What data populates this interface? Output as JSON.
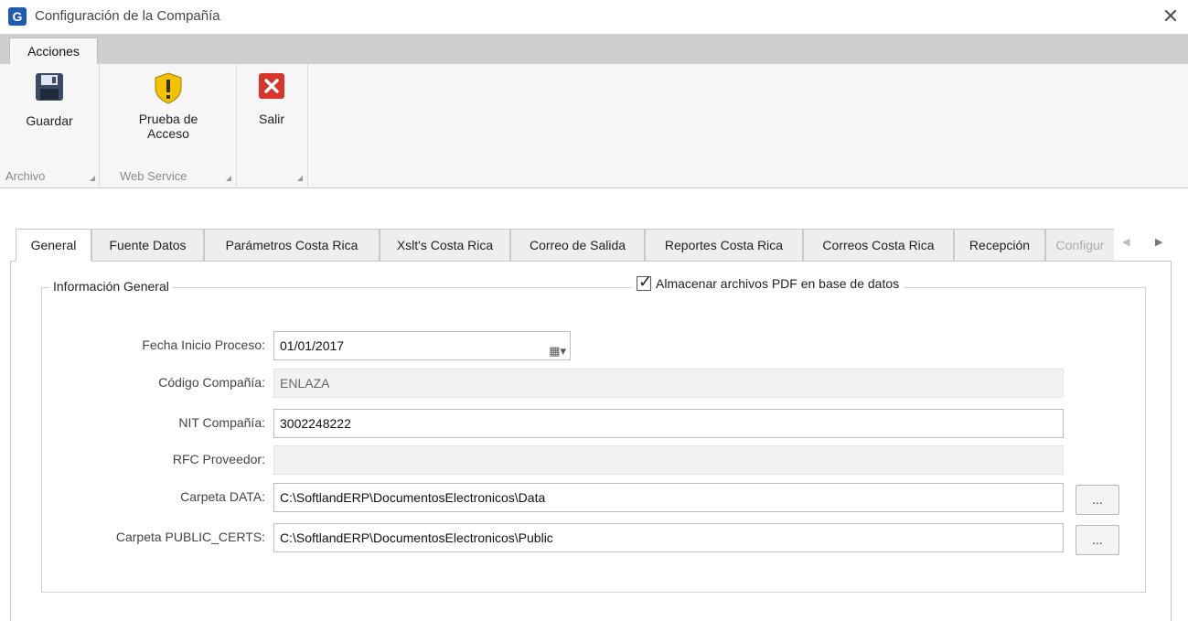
{
  "window": {
    "title": "Configuración de la Compañía",
    "app_icon": "G"
  },
  "ribbon": {
    "tab_label": "Acciones",
    "groups": [
      {
        "label": "Archivo",
        "button": "Guardar",
        "icon": "save-icon"
      },
      {
        "label": "Web Service",
        "button_line1": "Prueba de",
        "button_line2": "Acceso",
        "icon": "shield-warning-icon"
      },
      {
        "label": "",
        "button": "Salir",
        "icon": "exit-icon"
      }
    ]
  },
  "tabs": [
    "General",
    "Fuente Datos",
    "Parámetros Costa Rica",
    "Xslt's Costa Rica",
    "Correo de Salida",
    "Reportes Costa Rica",
    "Correos Costa Rica",
    "Recepción",
    "Configur"
  ],
  "general": {
    "group_title": "Información General",
    "pdf_checkbox_label": "Almacenar archivos PDF en base de datos",
    "pdf_checkbox_checked": true,
    "fields": {
      "fecha_label": "Fecha Inicio Proceso:",
      "fecha_value": "01/01/2017",
      "codigo_label": "Código Compañía:",
      "codigo_value": "ENLAZA",
      "nit_label": "NIT Compañía:",
      "nit_value": "3002248222",
      "rfc_label": "RFC Proveedor:",
      "rfc_value": "",
      "data_label": "Carpeta DATA:",
      "data_value": "C:\\SoftlandERP\\DocumentosElectronicos\\Data",
      "certs_label": "Carpeta PUBLIC_CERTS:",
      "certs_value": "C:\\SoftlandERP\\DocumentosElectronicos\\Public"
    },
    "browse_label": "..."
  }
}
